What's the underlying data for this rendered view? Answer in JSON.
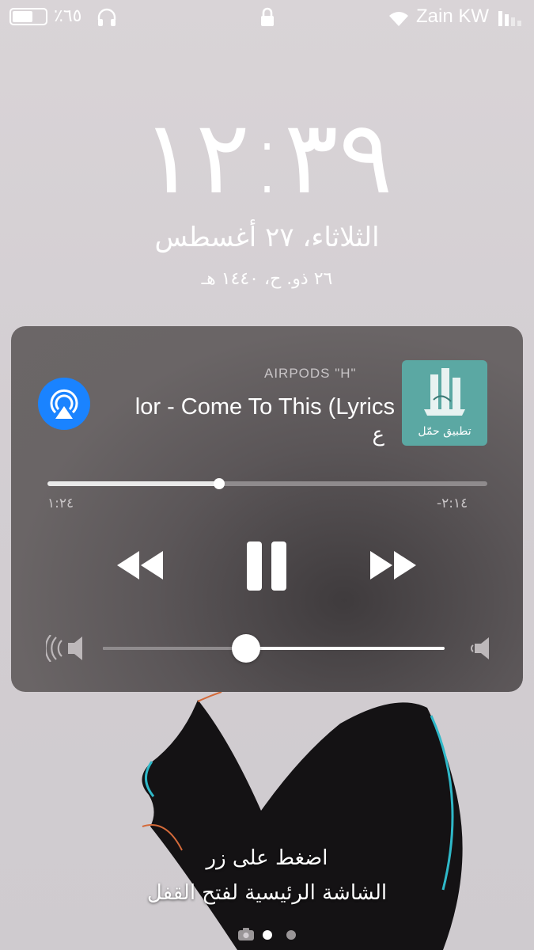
{
  "status_bar": {
    "battery_label": "٪٦٥",
    "battery_level": 0.65,
    "carrier": "Zain KW",
    "icons": [
      "headphones-icon",
      "lock-icon",
      "wifi-icon",
      "signal-icon"
    ]
  },
  "lock_screen": {
    "time": "١٢:٣٩",
    "date": "الثلاثاء، ٢٧ أغسطس",
    "hijri_date": "٢٦ ذو. ح، ١٤٤٠ هـ"
  },
  "now_playing": {
    "device": "AIRPODS \"H\"",
    "title": "lor - Come To This (Lyrics",
    "artist": "ع",
    "album_label": "تطبيق حمّل",
    "elapsed": "١:٢٤",
    "remaining": "-٢:١٤",
    "progress": 0.39,
    "volume": 0.42,
    "accent_color": "#1a83ff",
    "controls": [
      "rewind-icon",
      "pause-icon",
      "fast-forward-icon"
    ]
  },
  "unlock_hint": {
    "line1": "اضغط على زر",
    "line2": "الشاشة الرئيسية لفتح القفل"
  },
  "pages": {
    "icons": [
      "camera-icon"
    ],
    "active_index": 0
  }
}
